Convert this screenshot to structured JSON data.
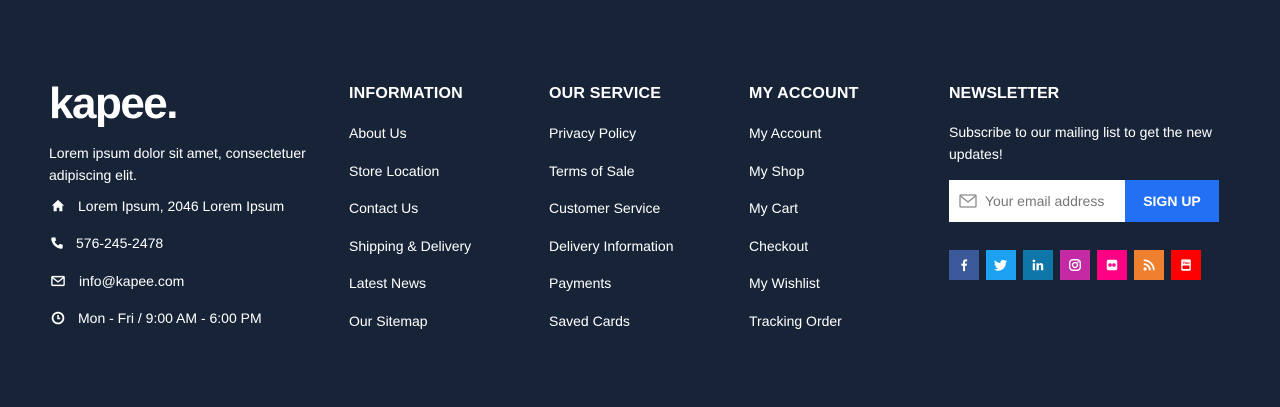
{
  "brand": {
    "logo": "kapee.",
    "description": "Lorem ipsum dolor sit amet, consectetuer adipiscing elit.",
    "contacts": [
      {
        "icon": "home-icon",
        "text": "Lorem Ipsum, 2046 Lorem Ipsum"
      },
      {
        "icon": "phone-icon",
        "text": "576-245-2478"
      },
      {
        "icon": "envelope-icon",
        "text": "info@kapee.com"
      },
      {
        "icon": "clock-icon",
        "text": "Mon - Fri / 9:00 AM - 6:00 PM"
      }
    ]
  },
  "columns": [
    {
      "title": "INFORMATION",
      "links": [
        "About Us",
        "Store Location",
        "Contact Us",
        "Shipping & Delivery",
        "Latest News",
        "Our Sitemap"
      ]
    },
    {
      "title": "OUR SERVICE",
      "links": [
        "Privacy Policy",
        "Terms of Sale",
        "Customer Service",
        "Delivery Information",
        "Payments",
        "Saved Cards"
      ]
    },
    {
      "title": "MY ACCOUNT",
      "links": [
        "My Account",
        "My Shop",
        "My Cart",
        "Checkout",
        "My Wishlist",
        "Tracking Order"
      ]
    }
  ],
  "newsletter": {
    "title": "NEWSLETTER",
    "text": "Subscribe to our mailing list to get the new updates!",
    "placeholder": "Your email address",
    "button_label": "SIGN UP",
    "button_color": "#2370f4"
  },
  "socials": [
    {
      "icon": "facebook-icon",
      "color": "#3b5998"
    },
    {
      "icon": "twitter-icon",
      "color": "#1da1f2"
    },
    {
      "icon": "linkedin-icon",
      "color": "#0e76a8"
    },
    {
      "icon": "instagram-icon",
      "color": "#c32aa3"
    },
    {
      "icon": "flickr-icon",
      "color": "#ff0084"
    },
    {
      "icon": "rss-icon",
      "color": "#ee802f"
    },
    {
      "icon": "youtube-icon",
      "color": "#ff0000"
    }
  ],
  "theme": {
    "background": "#172337",
    "text": "#ffffff"
  }
}
